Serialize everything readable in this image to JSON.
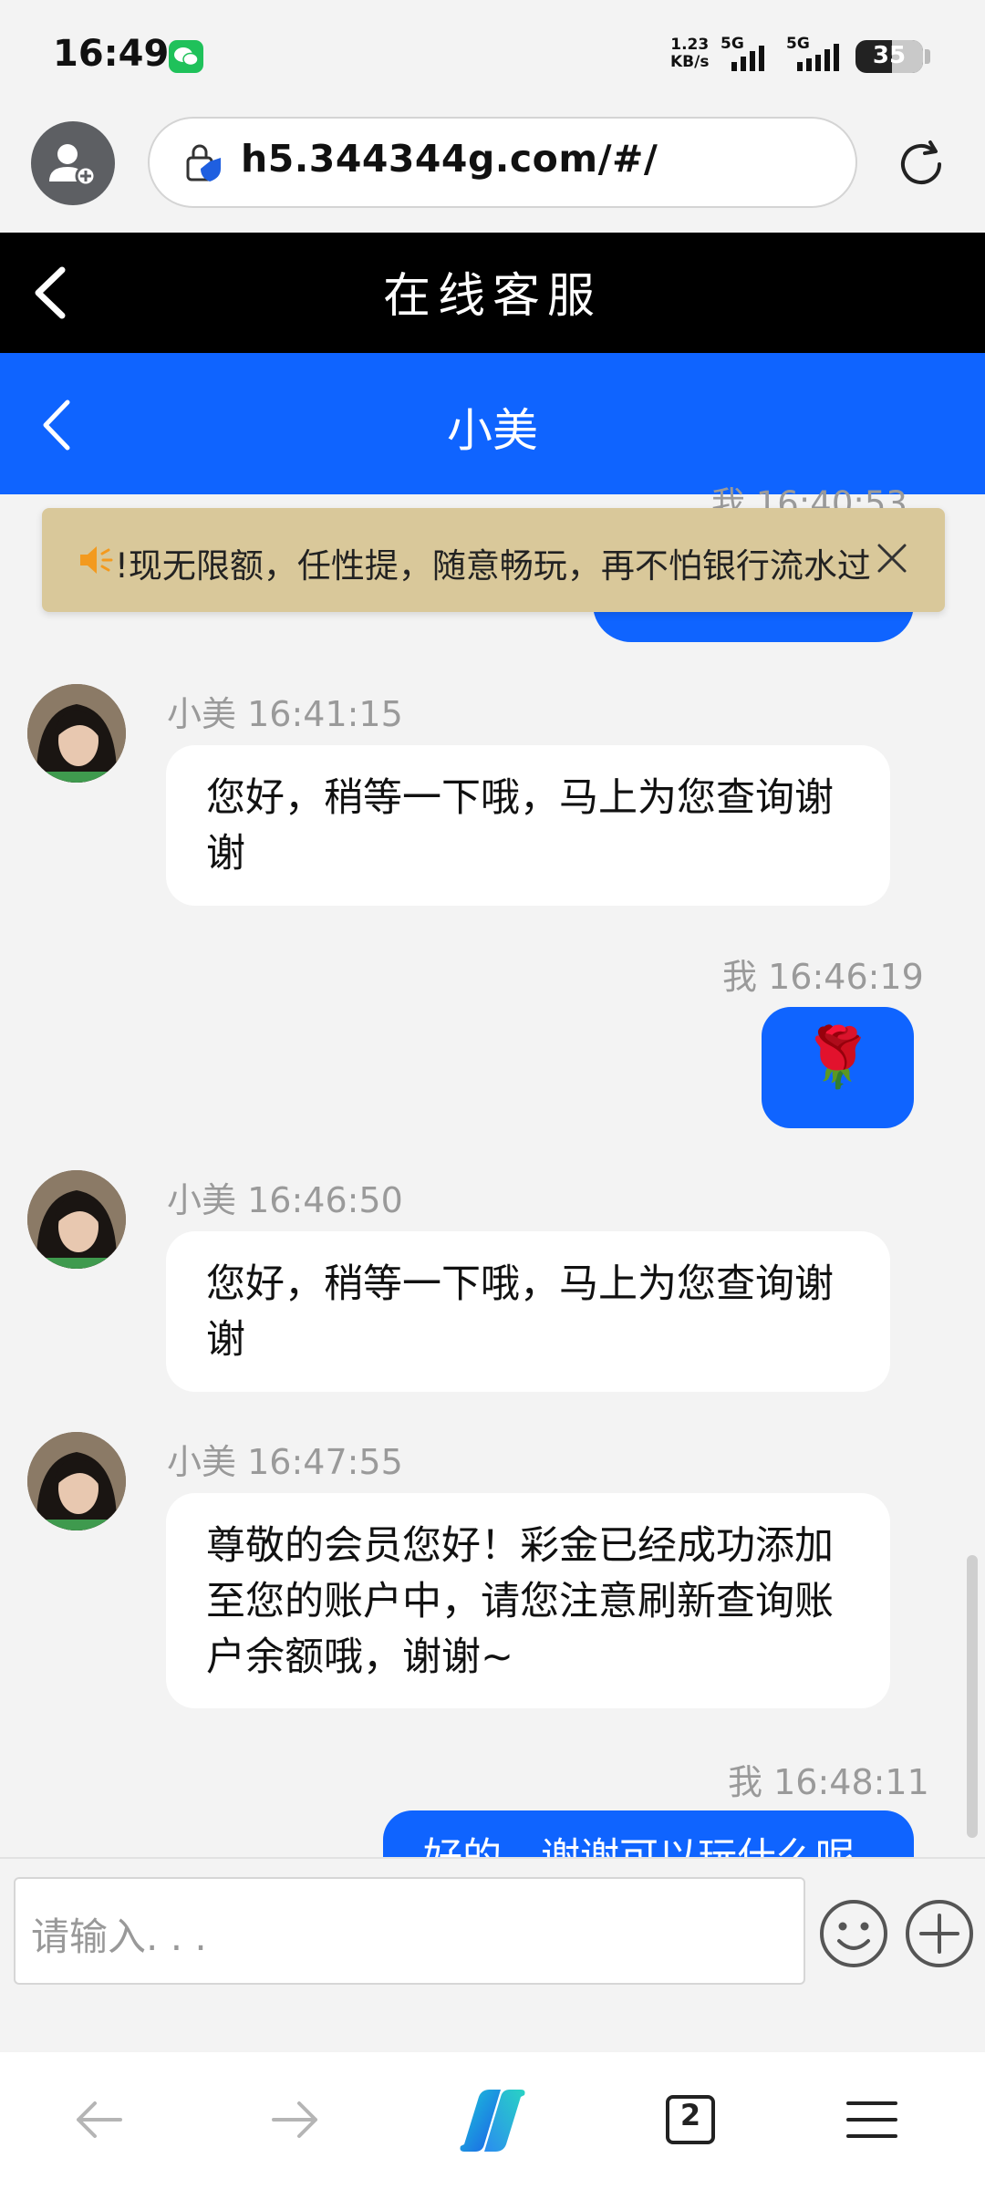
{
  "status_bar": {
    "time": "16:49",
    "net_speed_value": "1.23",
    "net_speed_unit": "KB/s",
    "signal1_label": "5G",
    "signal2_label": "5G",
    "battery": "35"
  },
  "browser": {
    "url": "h5.344344g.com/#/"
  },
  "header": {
    "title": "在线客服"
  },
  "chat_header": {
    "title": "小美"
  },
  "notice": {
    "text": "!现无限额，任性提，随意畅玩，再不怕银行流水过大"
  },
  "messages": {
    "partial_top_meta": "我 16:40:53",
    "m1": {
      "sender": "小美",
      "time": "16:41:15",
      "text": "您好，稍等一下哦，马上为您查询谢谢"
    },
    "m2": {
      "sender": "我",
      "time": "16:46:19",
      "emoji": "🌹"
    },
    "m3": {
      "sender": "小美",
      "time": "16:46:50",
      "text": "您好，稍等一下哦，马上为您查询谢谢"
    },
    "m4": {
      "sender": "小美",
      "time": "16:47:55",
      "text": "尊敬的会员您好！彩金已经成功添加至您的账户中，请您注意刷新查询账户余额哦，谢谢~"
    },
    "m5": {
      "sender": "我",
      "time": "16:48:11",
      "text": "好的，谢谢可以玩什么呢"
    }
  },
  "input": {
    "placeholder": "请输入. . ."
  },
  "bottom_nav": {
    "tab_count": "2"
  }
}
